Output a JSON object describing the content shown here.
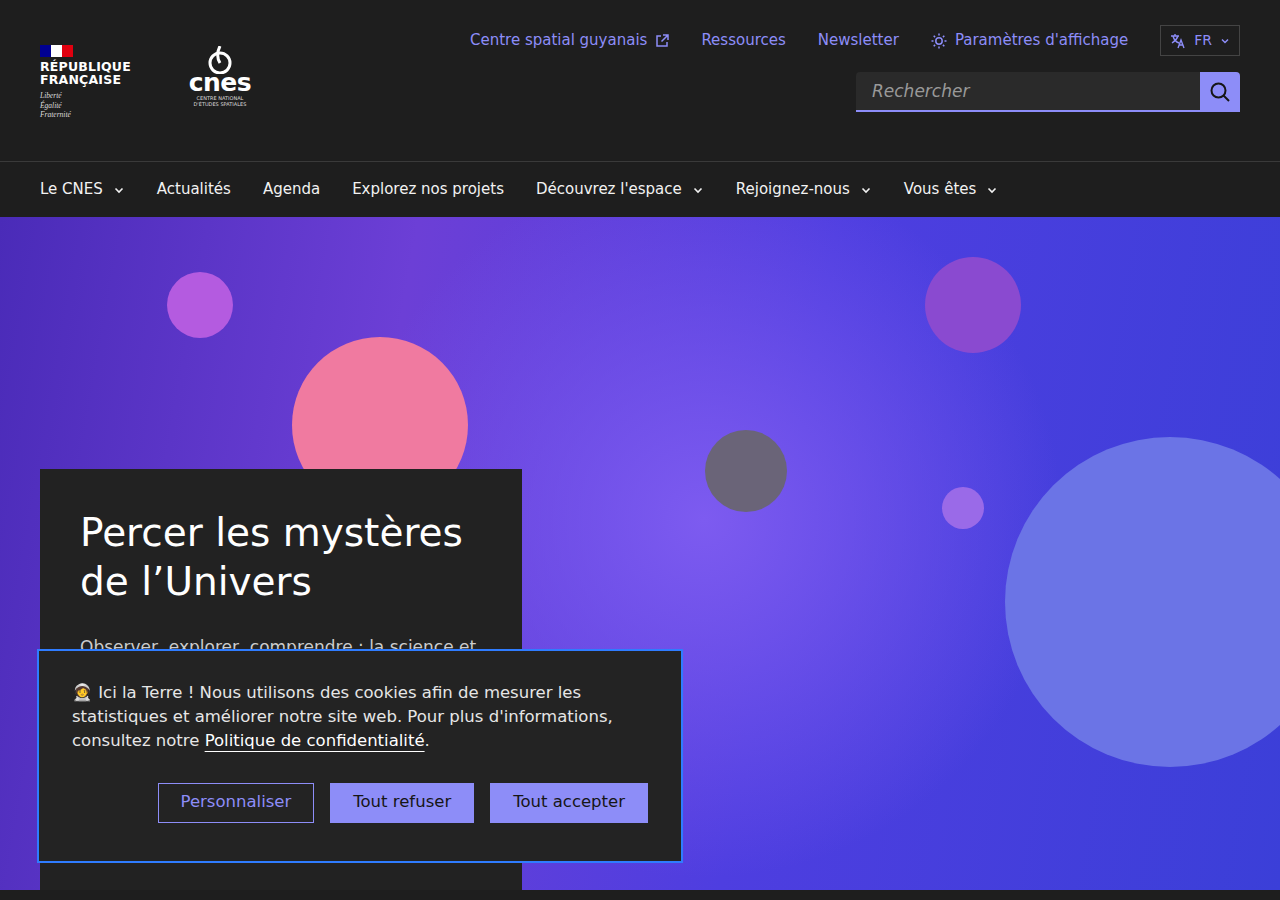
{
  "header": {
    "republique": {
      "lines": [
        "RÉPUBLIQUE",
        "FRANÇAISE"
      ],
      "motto": [
        "Liberté",
        "Égalité",
        "Fraternité"
      ]
    },
    "logo": {
      "name": "cnes",
      "subtitle": [
        "CENTRE NATIONAL",
        "D'ÉTUDES SPATIALES"
      ]
    },
    "top_links": [
      {
        "label": "Centre spatial guyanais",
        "kind": "external"
      },
      {
        "label": "Ressources",
        "kind": "plain"
      },
      {
        "label": "Newsletter",
        "kind": "plain"
      },
      {
        "label": "Paramètres d'affichage",
        "kind": "display"
      }
    ],
    "language": "FR",
    "search": {
      "placeholder": "Rechercher"
    }
  },
  "nav": [
    {
      "label": "Le CNES",
      "dropdown": true
    },
    {
      "label": "Actualités",
      "dropdown": false
    },
    {
      "label": "Agenda",
      "dropdown": false
    },
    {
      "label": "Explorez nos projets",
      "dropdown": false
    },
    {
      "label": "Découvrez l'espace",
      "dropdown": true
    },
    {
      "label": "Rejoignez-nous",
      "dropdown": true
    },
    {
      "label": "Vous êtes",
      "dropdown": true
    }
  ],
  "hero": {
    "title": "Percer les mystères de l’Univers",
    "text": "Observer, explorer, comprendre : la science et"
  },
  "cookie_banner": {
    "icon": "🧑‍🚀",
    "text": " Ici la Terre ! Nous utilisons des cookies afin de mesurer les statistiques et améliorer notre site web. Pour plus d'informations, consultez notre ",
    "link": "Politique de confidentialité",
    "end": ".",
    "buttons": [
      {
        "label": "Personnaliser",
        "kind": "outline"
      },
      {
        "label": "Tout refuser",
        "kind": "fill"
      },
      {
        "label": "Tout accepter",
        "kind": "fill"
      }
    ]
  }
}
